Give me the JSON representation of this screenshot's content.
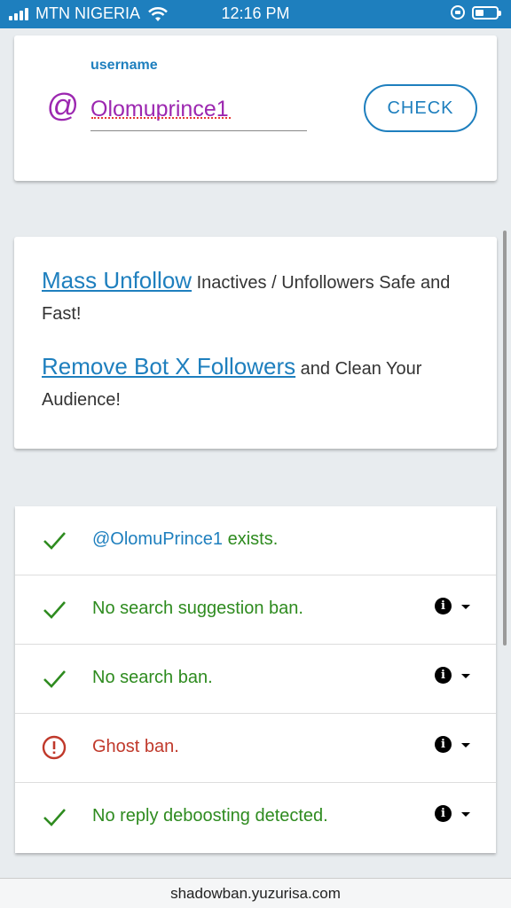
{
  "status_bar": {
    "carrier": "MTN NIGERIA",
    "time": "12:16 PM"
  },
  "username_card": {
    "label": "username",
    "value": "Olomuprince1",
    "at_symbol": "@",
    "check_button": "CHECK"
  },
  "ads": {
    "line1_link": "Mass Unfollow",
    "line1_text": " Inactives / Unfollowers Safe and Fast!",
    "line2_link": "Remove Bot X Followers",
    "line2_text": " and Clean Your Audience!"
  },
  "results": {
    "exists_user": "@OlomuPrince1",
    "exists_text": " exists.",
    "items": [
      {
        "text": "No search suggestion ban.",
        "status": "ok"
      },
      {
        "text": "No search ban.",
        "status": "ok"
      },
      {
        "text": "Ghost ban.",
        "status": "banned"
      },
      {
        "text": "No reply deboosting detected.",
        "status": "ok"
      }
    ]
  },
  "bottom_bar": {
    "url": "shadowban.yuzurisa.com"
  },
  "colors": {
    "accent": "#1e7fbe",
    "ok": "#2e8b1f",
    "banned": "#c0392b",
    "username": "#9c27b0"
  },
  "icons": {
    "ok": "check-icon",
    "banned": "alert-circle-icon",
    "info": "info-icon",
    "expand": "caret-down-icon"
  }
}
